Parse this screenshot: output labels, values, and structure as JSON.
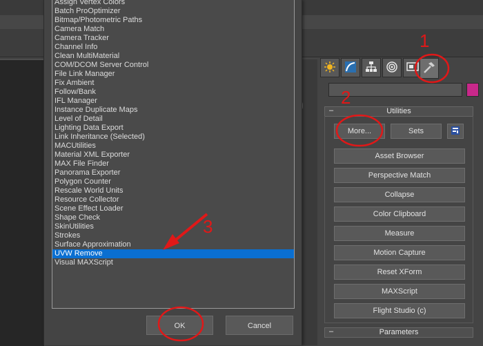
{
  "dialog": {
    "list_items": [
      "Assign Vertex Colors",
      "Batch ProOptimizer",
      "Bitmap/Photometric Paths",
      "Camera Match",
      "Camera Tracker",
      "Channel Info",
      "Clean MultiMaterial",
      "COM/DCOM Server Control",
      "File Link Manager",
      "Fix Ambient",
      "Follow/Bank",
      "IFL Manager",
      "Instance Duplicate Maps",
      "Level of Detail",
      "Lighting Data Export",
      "Link Inheritance (Selected)",
      "MACUtilities",
      "Material XML Exporter",
      "MAX File Finder",
      "Panorama Exporter",
      "Polygon Counter",
      "Rescale World Units",
      "Resource Collector",
      "Scene Effect Loader",
      "Shape Check",
      "SkinUtilities",
      "Strokes",
      "Surface Approximation",
      "UVW Remove",
      "Visual MAXScript"
    ],
    "selected_item": "UVW Remove",
    "ok_label": "OK",
    "cancel_label": "Cancel"
  },
  "command_panel": {
    "tabs": [
      "create-icon",
      "modify-icon",
      "hierarchy-icon",
      "motion-icon",
      "display-icon",
      "utilities-hammer-icon"
    ],
    "active_tab": "utilities-hammer-icon",
    "object_color": "#c8288a",
    "utilities": {
      "title": "Utilities",
      "more_label": "More...",
      "sets_label": "Sets",
      "buttons": [
        "Asset Browser",
        "Perspective Match",
        "Collapse",
        "Color Clipboard",
        "Measure",
        "Motion Capture",
        "Reset XForm",
        "MAXScript",
        "Flight Studio (c)"
      ]
    },
    "parameters_title": "Parameters"
  },
  "annotations": {
    "color": "#e01818",
    "step1": "1",
    "step2": "2",
    "step3": "3"
  }
}
